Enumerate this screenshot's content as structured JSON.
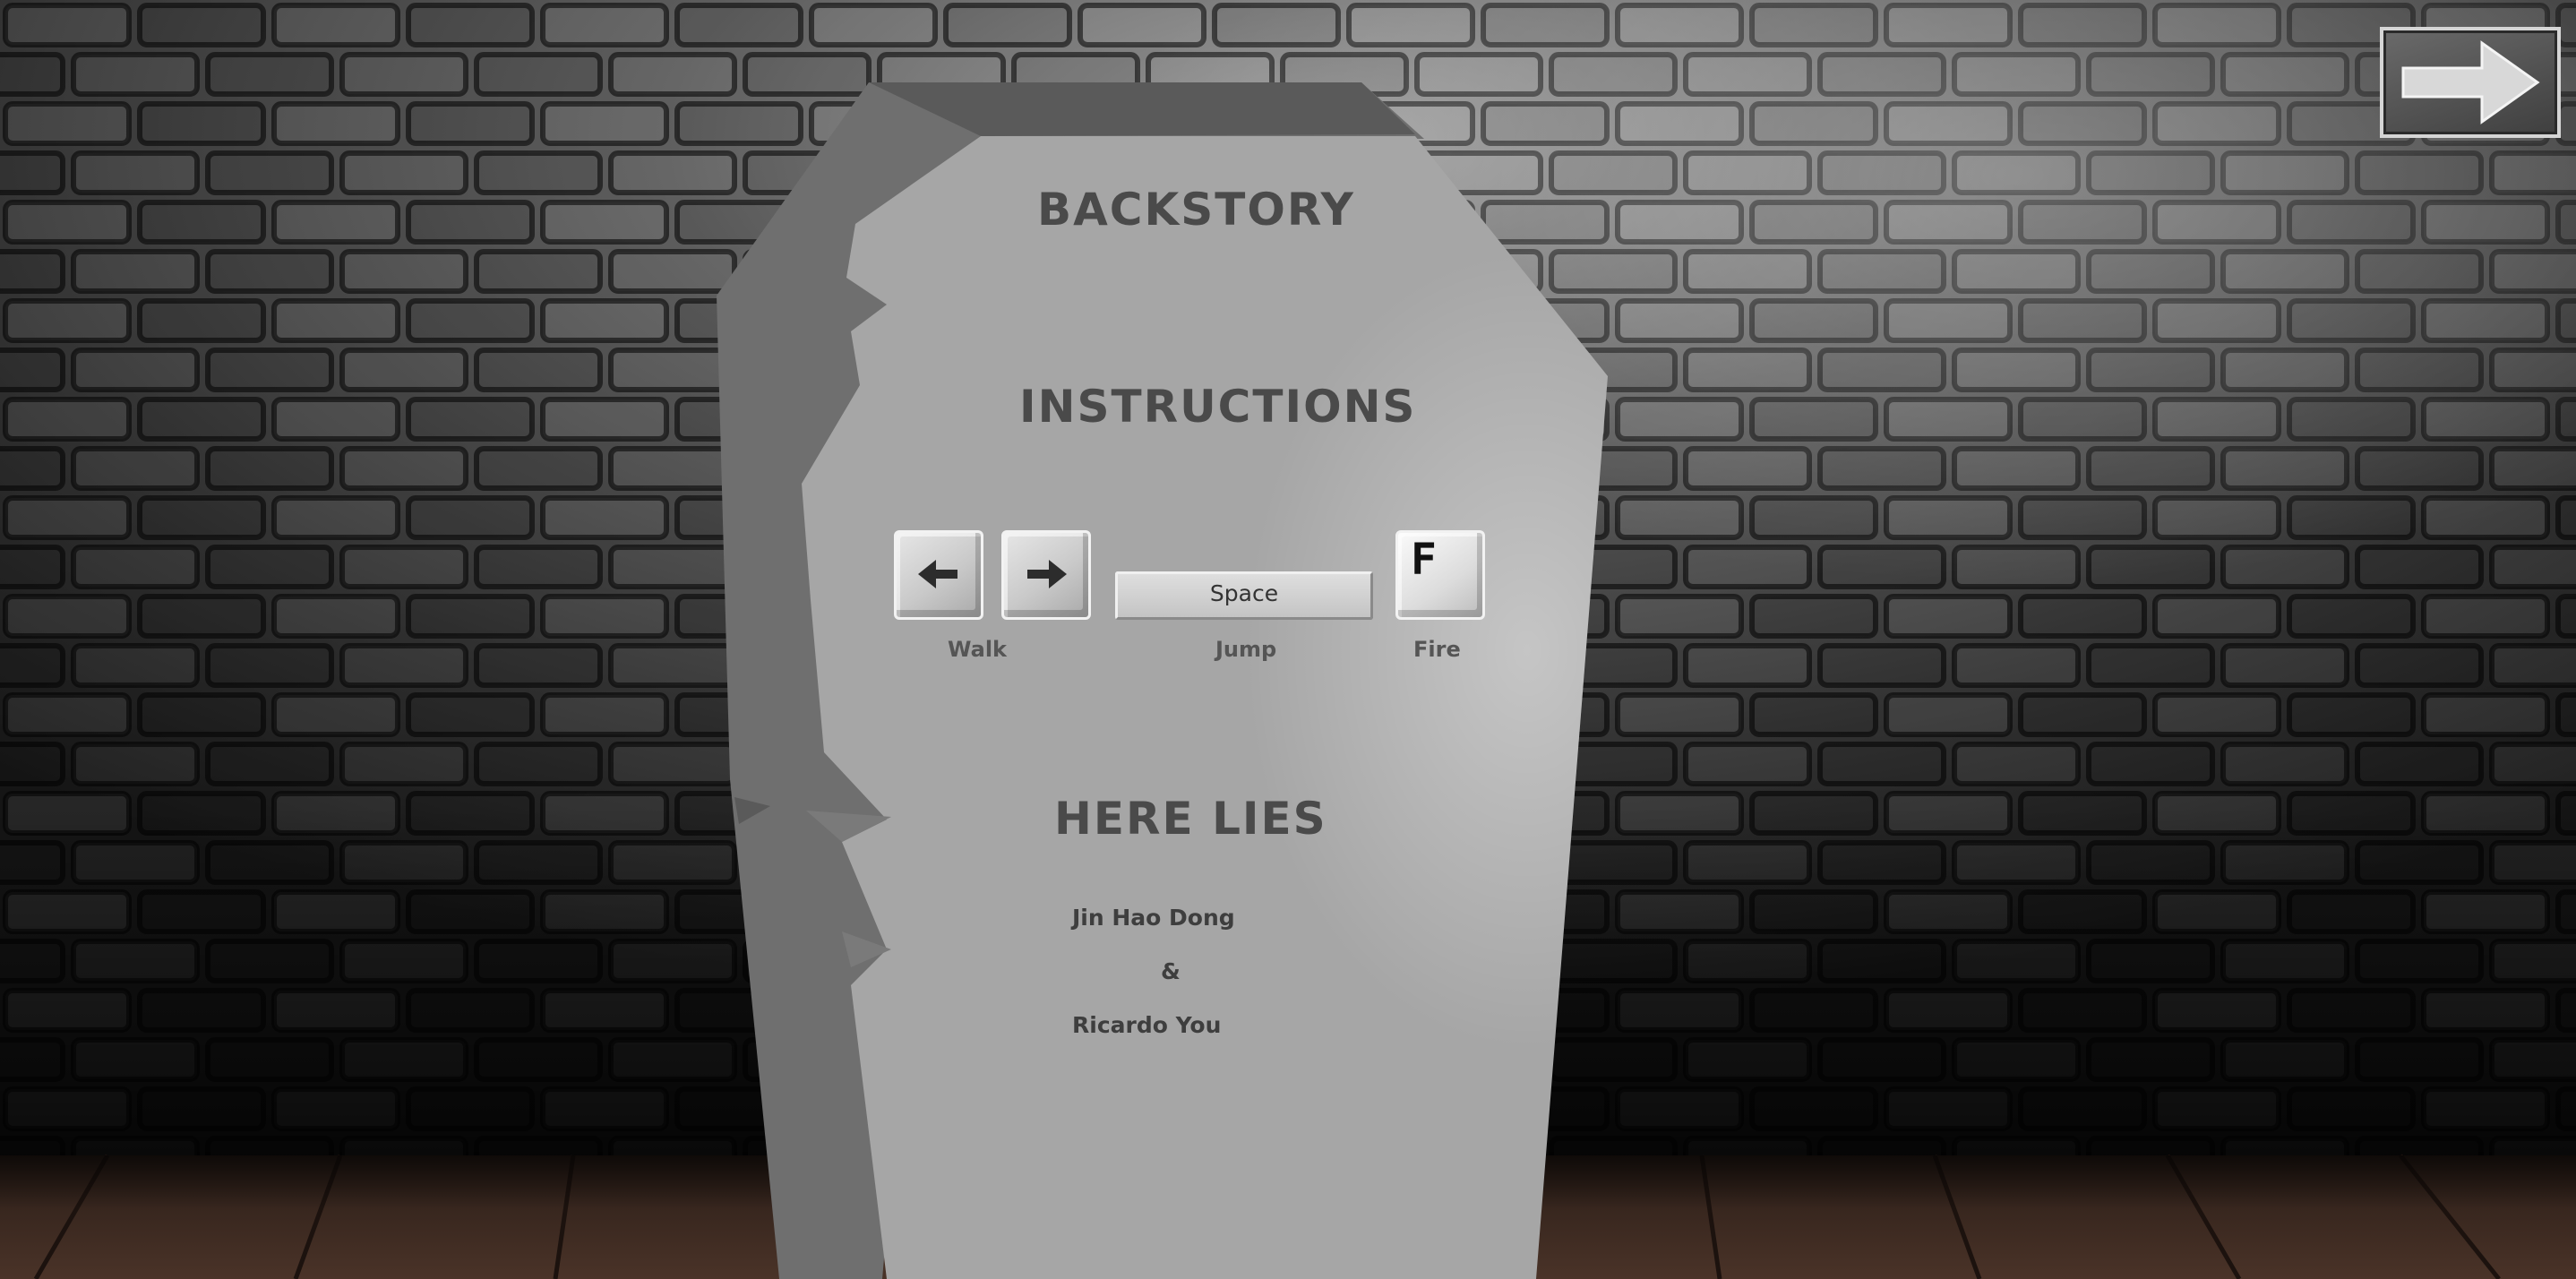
{
  "tombstone": {
    "backstory_heading": "BACKSTORY",
    "instructions_heading": "INSTRUCTIONS",
    "controls": {
      "walk_left_icon": "arrow-left-icon",
      "walk_right_icon": "arrow-right-icon",
      "space_key_label": "Space",
      "fire_key_label": "F",
      "walk_label": "Walk",
      "jump_label": "Jump",
      "fire_label": "Fire"
    },
    "here_lies_heading": "HERE LIES",
    "credits": {
      "author_1": "Jin Hao Dong",
      "ampersand": "&",
      "author_2": "Ricardo You"
    }
  },
  "navigation": {
    "next_icon": "arrow-right-icon"
  },
  "colors": {
    "stone_front": "#a6a6a6",
    "stone_side": "#6f6f6f",
    "stone_top": "#5e5e5e",
    "heading_text": "#4a4a4a",
    "wall": "#3a3a3a",
    "floor": "#3b2a22"
  }
}
